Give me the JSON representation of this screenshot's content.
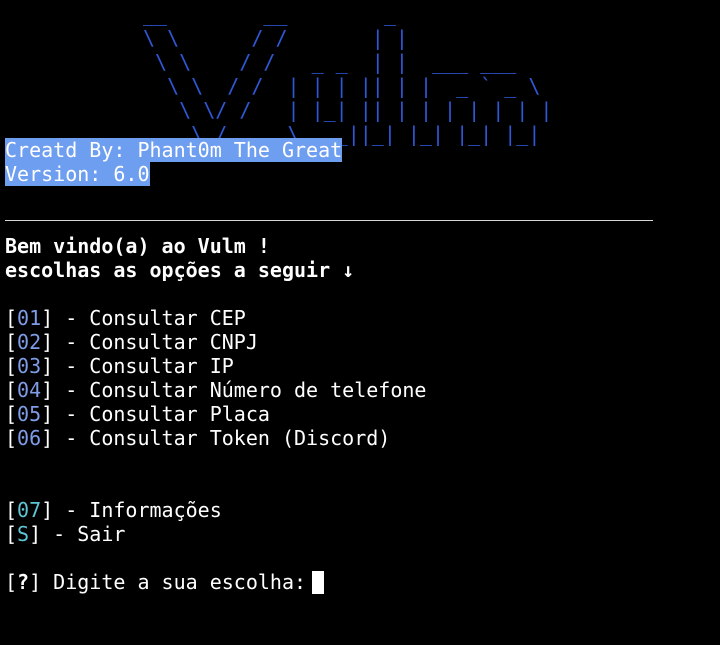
{
  "banner": {
    "art": "__        __        _\n\\ \\      / /       | |\n \\ \\    / /   _ _  | |  ___ ___\n  \\ \\  / /  | | | || | |  _ ` _ \\\n   \\ \\/ /   | |_| || | | | | | | |\n    \\_/     \\__,_||_| |_| |_| |_|",
    "color": "#2f58d6"
  },
  "credits": {
    "author": "Creatd By: Phant0m The Great",
    "version": "Version: 6.0",
    "highlight_color": "#6e9ef0"
  },
  "welcome": {
    "title": "Bem vindo(a) ao Vulm !",
    "subtitle": "escolhas as opções a seguir ↓"
  },
  "menu": {
    "items": [
      {
        "num": "01",
        "label": "] - Consultar CEP"
      },
      {
        "num": "02",
        "label": "] - Consultar CNPJ"
      },
      {
        "num": "03",
        "label": "] - Consultar IP"
      },
      {
        "num": "04",
        "label": "] - Consultar Número de telefone"
      },
      {
        "num": "05",
        "label": "] - Consultar Placa"
      },
      {
        "num": "06",
        "label": "] - Consultar Token (Discord)"
      }
    ],
    "extra": [
      {
        "num": "07",
        "label": "] - Informações"
      },
      {
        "num": "S",
        "label": "] - Sair"
      }
    ]
  },
  "prompt": {
    "mark": "?",
    "text": "] Digite a sua escolha:"
  }
}
